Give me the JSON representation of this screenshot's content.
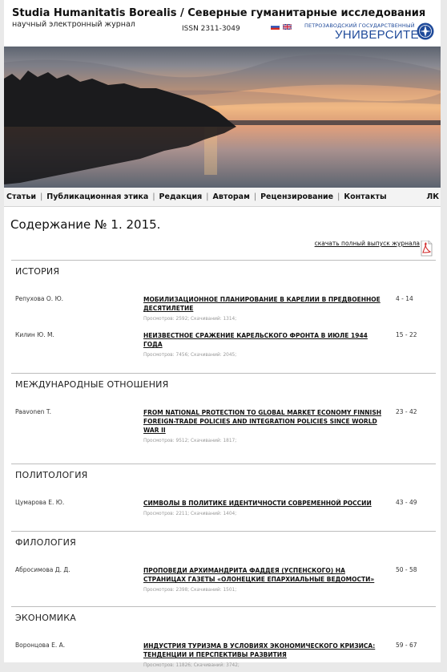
{
  "header": {
    "title": "Studia Humanitatis Borealis / Северные гуманитарные исследования",
    "subtitle": "научный электронный журнал",
    "issn": "ISSN 2311-3049",
    "university_top": "ПЕТРОЗАВОДСКИЙ ГОСУДАРСТВЕННЫЙ",
    "university_main": "УНИВЕРСИТЕТ"
  },
  "menu": {
    "items": [
      "Статьи",
      "Публикационная этика",
      "Редакция",
      "Авторам",
      "Рецензирование",
      "Контакты"
    ],
    "lk": "ЛК"
  },
  "content": {
    "title": "Содержание № 1. 2015.",
    "download_label": "скачать полный выпуск журнала"
  },
  "sections": [
    {
      "title": "ИСТОРИЯ",
      "articles": [
        {
          "author": "Репухова О. Ю.",
          "title": "МОБИЛИЗАЦИОННОЕ ПЛАНИРОВАНИЕ В КАРЕЛИИ В ПРЕДВОЕННОЕ ДЕСЯТИЛЕТИЕ",
          "stats": "Просмотров: 2592; Скачиваний: 1314;",
          "pages": "4 - 14"
        },
        {
          "author": "Килин Ю. М.",
          "title": "НЕИЗВЕСТНОЕ СРАЖЕНИЕ КАРЕЛЬСКОГО ФРОНТА В ИЮЛЕ 1944 ГОДА",
          "stats": "Просмотров: 7456; Скачиваний: 2045;",
          "pages": "15 - 22"
        }
      ]
    },
    {
      "title": "МЕЖДУНАРОДНЫЕ ОТНОШЕНИЯ",
      "articles": [
        {
          "author": "Paavonen T.",
          "title": "FROM NATIONAL PROTECTION TO GLOBAL MARKET ECONOMY FINNISH FOREIGN-TRADE POLICIES AND INTEGRATION POLICIES SINCE WORLD WAR II",
          "stats": "Просмотров: 9512; Скачиваний: 1817;",
          "pages": "23 - 42"
        }
      ]
    },
    {
      "title": "ПОЛИТОЛОГИЯ",
      "articles": [
        {
          "author": "Цумарова Е. Ю.",
          "title": "СИМВОЛЫ В ПОЛИТИКЕ ИДЕНТИЧНОСТИ СОВРЕМЕННОЙ РОССИИ",
          "stats": "Просмотров: 2211; Скачиваний: 1404;",
          "pages": "43 - 49"
        }
      ]
    },
    {
      "title": "ФИЛОЛОГИЯ",
      "articles": [
        {
          "author": "Абросимова Д. Д.",
          "title": "ПРОПОВЕДИ АРХИМАНДРИТА ФАДДЕЯ (УСПЕНСКОГО) НА СТРАНИЦАХ ГАЗЕТЫ «ОЛОНЕЦКИЕ ЕПАРХИАЛЬНЫЕ ВЕДОМОСТИ»",
          "stats": "Просмотров: 2398; Скачиваний: 1501;",
          "pages": "50 - 58"
        }
      ]
    },
    {
      "title": "ЭКОНОМИКА",
      "articles": [
        {
          "author": "Воронцова Е. А.",
          "title": "ИНДУСТРИЯ ТУРИЗМА В УСЛОВИЯХ ЭКОНОМИЧЕСКОГО КРИЗИСА: ТЕНДЕНЦИИ И ПЕРСПЕКТИВЫ РАЗВИТИЯ",
          "stats": "Просмотров: 11826; Скачиваний: 3742;",
          "pages": "59 - 67"
        }
      ]
    }
  ],
  "colors": {
    "university_blue": "#1f4a9a",
    "pdf_red": "#d32f2f",
    "separator": "#bdbdbd"
  },
  "icons": {
    "flags": [
      "russian-flag-icon",
      "uk-flag-icon"
    ],
    "pdf": "pdf-icon",
    "emblem": "university-emblem-icon"
  }
}
